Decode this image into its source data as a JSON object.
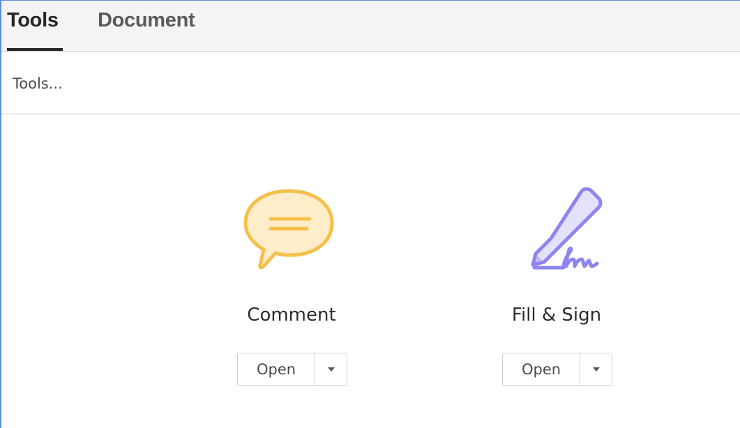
{
  "tabs": {
    "tools_label": "Tools",
    "document_label": "Document",
    "active": "Tools"
  },
  "search": {
    "text": "Tools..."
  },
  "tools": [
    {
      "label": "Comment",
      "icon": "comment-icon",
      "color": "#f5c04a",
      "open_label": "Open"
    },
    {
      "label": "Fill & Sign",
      "icon": "fill-sign-icon",
      "color": "#8c85f2",
      "open_label": "Open"
    }
  ],
  "colors": {
    "frame": "#5b8ed6",
    "active_tab": "#262626",
    "inactive_tab": "#5a5a5a"
  }
}
